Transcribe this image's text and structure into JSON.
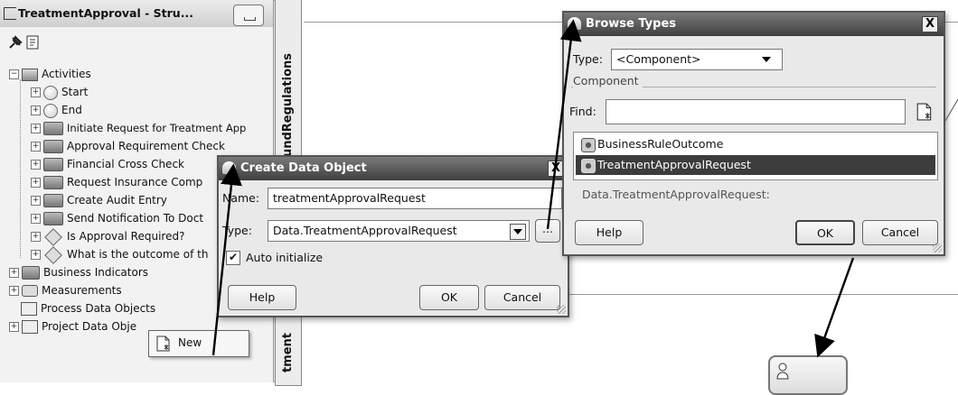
{
  "structure_panel": {
    "title": "TreatmentApproval - Stru...",
    "tree": [
      {
        "label": "Activities",
        "icon": "folder-icon",
        "level": 0
      },
      {
        "label": "Start",
        "icon": "start-event-icon",
        "level": 1
      },
      {
        "label": "End",
        "icon": "end-event-icon",
        "level": 1
      },
      {
        "label": "Initiate Request for Treatment App",
        "icon": "human-task-icon",
        "level": 1
      },
      {
        "label": "Approval Requirement Check",
        "icon": "business-rule-icon",
        "level": 1
      },
      {
        "label": "Financial Cross Check",
        "icon": "human-task-icon",
        "level": 1
      },
      {
        "label": "Request Insurance Comp",
        "icon": "service-task-icon",
        "level": 1
      },
      {
        "label": "Create Audit Entry",
        "icon": "service-task-icon",
        "level": 1
      },
      {
        "label": "Send Notification To Doct",
        "icon": "service-task-icon",
        "level": 1
      },
      {
        "label": "Is Approval Required?",
        "icon": "gateway-icon",
        "level": 1
      },
      {
        "label": "What is the outcome of th",
        "icon": "gateway-icon",
        "level": 1
      },
      {
        "label": "Business Indicators",
        "icon": "indicators-icon",
        "level": 0
      },
      {
        "label": "Measurements",
        "icon": "measurements-icon",
        "level": 0
      },
      {
        "label": "Process Data Objects",
        "icon": "data-object-icon",
        "level": 0
      },
      {
        "label": "Project Data Obje",
        "icon": "data-object-icon",
        "level": 0
      }
    ],
    "context_menu": {
      "new_label": "New"
    }
  },
  "canvas": {
    "lane_label_top": "undRegulations",
    "lane_label_bottom": "tment"
  },
  "create_dialog": {
    "title": "Create Data Object",
    "name_label": "Name:",
    "name_value": "treatmentApprovalRequest",
    "type_label": "Type:",
    "type_value": "Data.TreatmentApprovalRequest",
    "browse_label": "...",
    "auto_init_label": "Auto initialize",
    "auto_init_checked": true,
    "help_label": "Help",
    "ok_label": "OK",
    "cancel_label": "Cancel",
    "close_label": "X"
  },
  "browse_dialog": {
    "title": "Browse Types",
    "type_label": "Type:",
    "type_value": "<Component>",
    "group_label": "Component",
    "find_label": "Find:",
    "find_value": "",
    "items": [
      {
        "label": "BusinessRuleOutcome",
        "selected": false
      },
      {
        "label": "TreatmentApprovalRequest",
        "selected": true
      }
    ],
    "status": "Data.TreatmentApprovalRequest:",
    "help_label": "Help",
    "ok_label": "OK",
    "cancel_label": "Cancel",
    "close_label": "X"
  },
  "colors": {
    "selection": "#3c3c3c",
    "title_bar": "#4a4a4a",
    "panel": "#f2f2f2"
  }
}
